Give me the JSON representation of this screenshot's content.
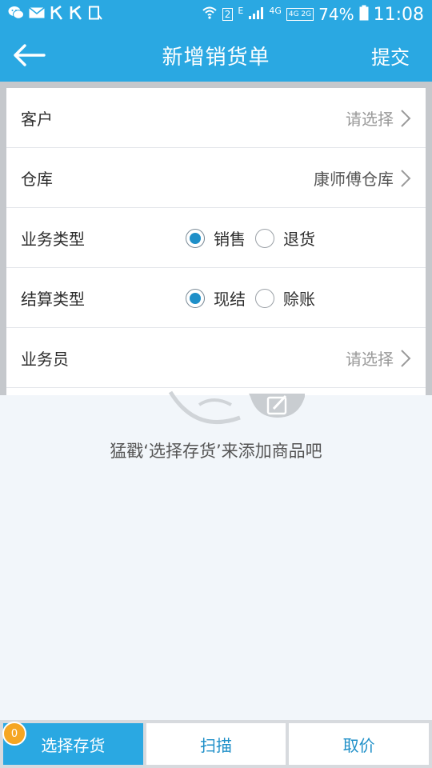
{
  "status_bar": {
    "battery": "74%",
    "time": "11:08",
    "network_label": "4G",
    "sim_label": "2",
    "signal_box": "4G 2G",
    "e_label": "E"
  },
  "app_bar": {
    "title": "新增销货单",
    "submit_label": "提交",
    "back_icon": "arrow-left-icon"
  },
  "form": {
    "customer": {
      "label": "客户",
      "value": "请选择"
    },
    "warehouse": {
      "label": "仓库",
      "value": "康师傅仓库"
    },
    "business_type": {
      "label": "业务类型",
      "options": [
        "销售",
        "退货"
      ],
      "selected": "销售"
    },
    "settlement_type": {
      "label": "结算类型",
      "options": [
        "现结",
        "赊账"
      ],
      "selected": "现结"
    },
    "salesperson": {
      "label": "业务员",
      "value": "请选择"
    }
  },
  "empty_state": {
    "hint": "猛戳‘选择存货’来添加商品吧"
  },
  "bottom_bar": {
    "select_stock_label": "选择存货",
    "badge_count": "0",
    "scan_label": "扫描",
    "price_label": "取价"
  },
  "colors": {
    "primary": "#2aa8e2",
    "radio_selected": "#1e8fc8",
    "badge": "#f5a623"
  }
}
